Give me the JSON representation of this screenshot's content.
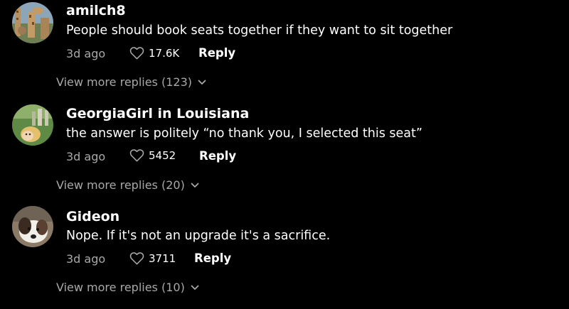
{
  "comments": [
    {
      "avatar_icon": "giraffe-photo-avatar",
      "username": "amilch8",
      "text": "People should book seats together if they want to sit together",
      "date": "3d ago",
      "likes": "17.6K",
      "reply_label": "Reply",
      "view_more": "View more replies (123)"
    },
    {
      "avatar_icon": "child-outdoor-photo-avatar",
      "username": "GeorgiaGirl in Louisiana",
      "text": "the answer is politely “no thank you, I selected this seat”",
      "date": "3d ago",
      "likes": "5452",
      "reply_label": "Reply",
      "view_more": "View more replies (20)"
    },
    {
      "avatar_icon": "dog-photo-avatar",
      "username": "Gideon",
      "text": "Nope. If it's not an upgrade it's a sacrifice.",
      "date": "3d ago",
      "likes": "3711",
      "reply_label": "Reply",
      "view_more": "View more replies (10)"
    }
  ],
  "colors": {
    "background": "#000000",
    "primary_text": "#ffffff",
    "secondary_text": "#a8a8a8"
  }
}
